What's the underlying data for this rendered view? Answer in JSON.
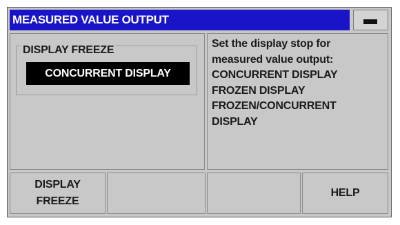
{
  "title": "MEASURED VALUE OUTPUT",
  "minimize_icon": "minus-bar-icon",
  "settings": {
    "group_label": "DISPLAY FREEZE",
    "selected_value": "CONCURRENT DISPLAY"
  },
  "help": {
    "lines": [
      "Set the display stop for",
      "measured value output:",
      "CONCURRENT DISPLAY",
      "FROZEN DISPLAY",
      "FROZEN/CONCURRENT",
      "DISPLAY"
    ]
  },
  "softkeys": [
    {
      "line1": "DISPLAY",
      "line2": "FREEZE"
    },
    {
      "line1": "",
      "line2": ""
    },
    {
      "line1": "",
      "line2": ""
    },
    {
      "line1": "HELP",
      "line2": ""
    }
  ]
}
